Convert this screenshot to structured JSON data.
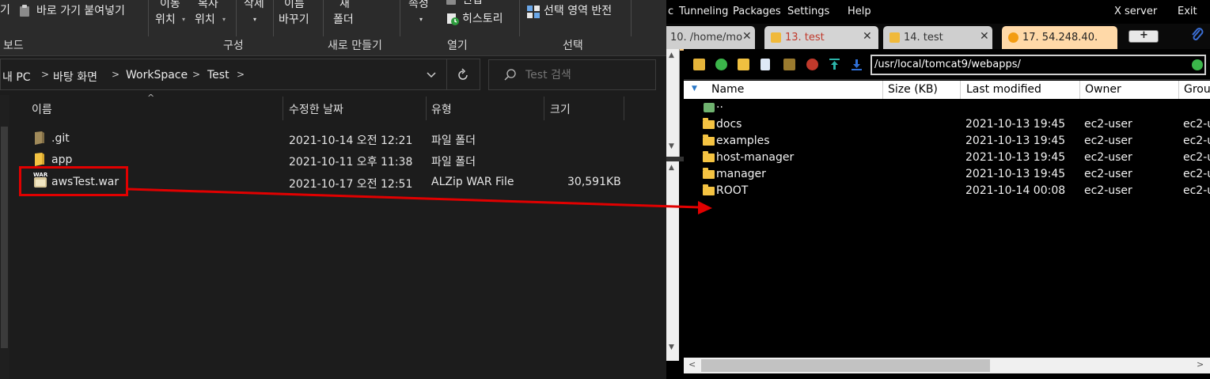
{
  "explorer": {
    "ribbon": {
      "clipboard": {
        "frag_left": "기",
        "paste_shortcut": "바로 가기 붙여넣기",
        "group_label": "보드"
      },
      "organize": {
        "move_to_l1": "이동",
        "move_to_l2": "위치",
        "copy_to_l1": "복사",
        "copy_to_l2": "위치",
        "delete": "삭제",
        "rename_l1": "이름",
        "rename_l2": "바꾸기",
        "group_label": "구성"
      },
      "new": {
        "new_folder_l1": "새",
        "new_folder_l2": "폴더",
        "group_label": "새로 만들기"
      },
      "open": {
        "properties": "속성",
        "edit": "편집",
        "history": "히스토리",
        "group_label": "열기"
      },
      "select": {
        "invert_selection": "선택 영역 반전",
        "group_label": "선택"
      }
    },
    "address": {
      "crumbs": [
        "내 PC",
        "바탕 화면",
        "WorkSpace",
        "Test"
      ]
    },
    "search": {
      "placeholder": "Test 검색"
    },
    "columns": {
      "name": "이름",
      "modified": "수정한 날짜",
      "type": "유형",
      "size": "크기"
    },
    "files": [
      {
        "name": ".git",
        "modified": "2021-10-14 오전 12:21",
        "type": "파일 폴더",
        "size": "",
        "icon": "folder-icon"
      },
      {
        "name": "app",
        "modified": "2021-10-11 오후 11:38",
        "type": "파일 폴더",
        "size": "",
        "icon": "folder-icon"
      },
      {
        "name": "awsTest.war",
        "modified": "2021-10-17 오전 12:51",
        "type": "ALZip WAR File",
        "size": "30,591KB",
        "icon": "war-file-icon"
      }
    ],
    "war_badge": "WAR"
  },
  "moba": {
    "menu": {
      "frag": "c",
      "tunneling": "Tunneling",
      "packages": "Packages",
      "settings": "Settings",
      "help": "Help",
      "xserver": "X server",
      "exit": "Exit"
    },
    "tabs": [
      {
        "label": "10. /home/mo",
        "active": false
      },
      {
        "label": "13. test",
        "active": false,
        "color": "#c0392b"
      },
      {
        "label": "14. test",
        "active": false
      },
      {
        "label": "17. 54.248.40.",
        "active": true
      }
    ],
    "sftp": {
      "path": "/usr/local/tomcat9/webapps/",
      "columns": {
        "name": "Name",
        "size": "Size (KB)",
        "modified": "Last modified",
        "owner": "Owner",
        "group": "Grou"
      },
      "parent": "..",
      "rows": [
        {
          "name": "docs",
          "modified": "2021-10-13 19:45",
          "owner": "ec2-user",
          "group": "ec2-u"
        },
        {
          "name": "examples",
          "modified": "2021-10-13 19:45",
          "owner": "ec2-user",
          "group": "ec2-u"
        },
        {
          "name": "host-manager",
          "modified": "2021-10-13 19:45",
          "owner": "ec2-user",
          "group": "ec2-u"
        },
        {
          "name": "manager",
          "modified": "2021-10-13 19:45",
          "owner": "ec2-user",
          "group": "ec2-u"
        },
        {
          "name": "ROOT",
          "modified": "2021-10-14 00:08",
          "owner": "ec2-user",
          "group": "ec2-u"
        }
      ]
    }
  },
  "colors": {
    "highlight_red": "#e10000",
    "folder_yellow": "#f4c342",
    "active_tab": "#ffd9a8"
  }
}
